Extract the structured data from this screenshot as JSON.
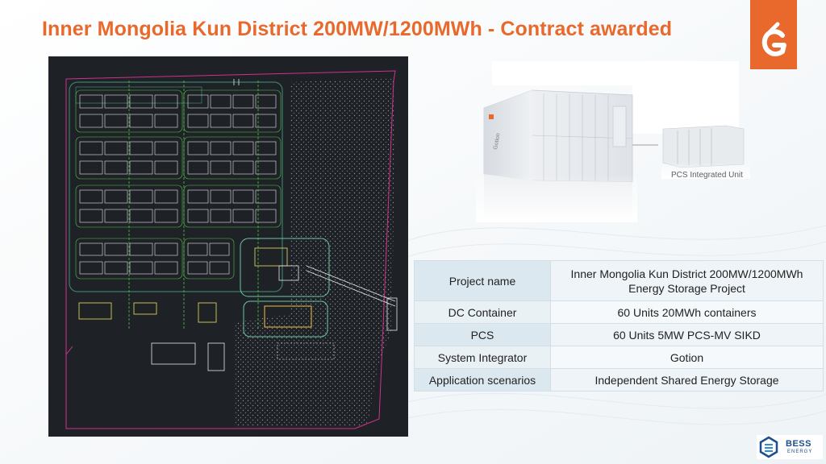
{
  "slide": {
    "title": "Inner Mongolia Kun District 200MW/1200MWh - Contract awarded",
    "accent_color": "#e8692b",
    "background_icon": "wave-lines-background"
  },
  "product": {
    "container_brand": "Gotion",
    "pcs_label": "PCS Integrated Unit"
  },
  "table": {
    "rows": [
      {
        "key": "Project name",
        "value": "Inner Mongolia Kun District 200MW/1200MWh Energy Storage Project"
      },
      {
        "key": "DC Container",
        "value": "60 Units 20MWh containers"
      },
      {
        "key": "PCS",
        "value": "60 Units  5MW PCS-MV SIKD"
      },
      {
        "key": "System Integrator",
        "value": "Gotion"
      },
      {
        "key": "Application scenarios",
        "value": "Independent Shared Energy Storage"
      }
    ]
  },
  "branding": {
    "logo_icon": "gotion-logo",
    "bess_name": "BESS",
    "bess_sub": "ENERGY"
  }
}
